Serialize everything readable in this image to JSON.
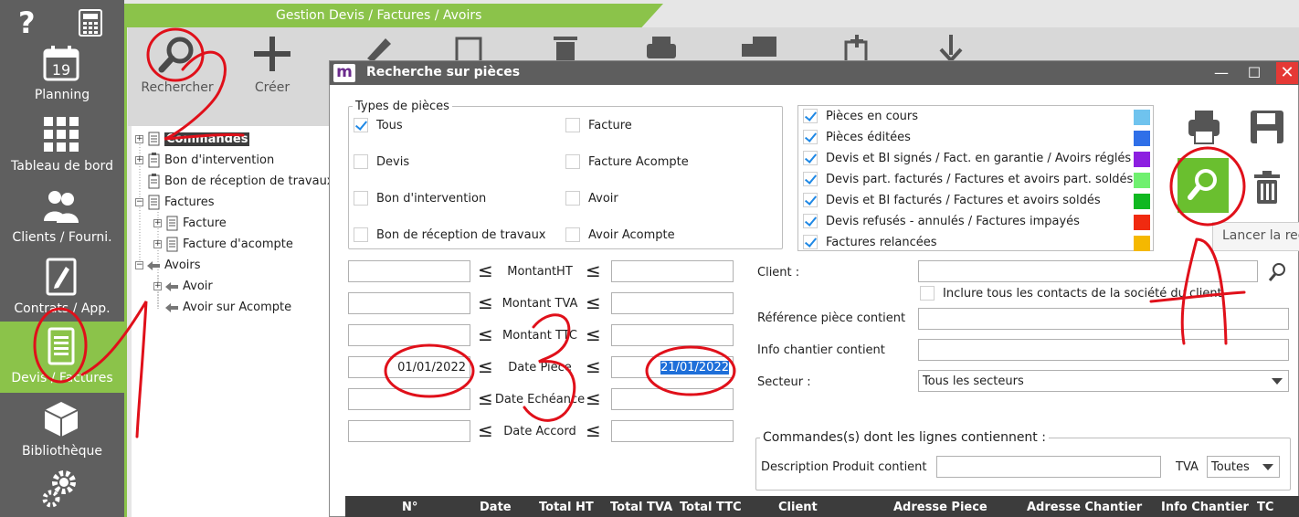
{
  "sidebar": {
    "help_label": "?",
    "items": [
      {
        "label": "Planning",
        "icon": "calendar-icon",
        "day": "19"
      },
      {
        "label": "Tableau de bord",
        "icon": "dashboard-grid-icon"
      },
      {
        "label": "Clients / Fourni.",
        "icon": "users-icon"
      },
      {
        "label": "Contrats / App.",
        "icon": "contract-icon"
      },
      {
        "label": "Devis / Factures",
        "icon": "document-icon",
        "active": true
      },
      {
        "label": "Bibliothèque",
        "icon": "cube-icon"
      }
    ]
  },
  "header": {
    "title": "Gestion Devis / Factures / Avoirs"
  },
  "toolbar": {
    "search_label": "Rechercher",
    "create_label": "Créer"
  },
  "tree": {
    "nodes": [
      {
        "label": "Commandes",
        "selected": true
      },
      {
        "label": "Bon d'intervention"
      },
      {
        "label": "Bon de réception de travaux"
      },
      {
        "label": "Factures"
      },
      {
        "label": "Facture"
      },
      {
        "label": "Facture d'acompte"
      },
      {
        "label": "Avoirs"
      },
      {
        "label": "Avoir"
      },
      {
        "label": "Avoir sur Acompte"
      }
    ]
  },
  "dialog": {
    "logo": "m",
    "title": "Recherche sur pièces",
    "types_legend": "Types de pièces",
    "types": [
      {
        "label": "Tous",
        "checked": true
      },
      {
        "label": "Facture",
        "checked": false
      },
      {
        "label": "Devis",
        "checked": false
      },
      {
        "label": "Facture Acompte",
        "checked": false
      },
      {
        "label": "Bon d'intervention",
        "checked": false
      },
      {
        "label": "Avoir",
        "checked": false
      },
      {
        "label": "Bon de réception de travaux",
        "checked": false
      },
      {
        "label": "Avoir Acompte",
        "checked": false
      }
    ],
    "statuses": [
      {
        "label": "Pièces en cours",
        "color": "#6fc3ee"
      },
      {
        "label": "Pièces éditées",
        "color": "#2f6fe8"
      },
      {
        "label": "Devis et BI signés / Fact. en garantie / Avoirs réglés",
        "color": "#8c1fe0"
      },
      {
        "label": "Devis part. facturés / Factures et avoirs part. soldés",
        "color": "#6ff06f"
      },
      {
        "label": "Devis et BI facturés / Factures  et avoirs soldés",
        "color": "#10b820"
      },
      {
        "label": "Devis refusés - annulés / Factures impayés",
        "color": "#f02a10"
      },
      {
        "label": "Factures relancées",
        "color": "#f5b800"
      }
    ],
    "tooltip": "Lancer la rech",
    "ranges": [
      {
        "label": "MontantHT",
        "from": "",
        "to": ""
      },
      {
        "label": "Montant TVA",
        "from": "",
        "to": ""
      },
      {
        "label": "Montant TTC",
        "from": "",
        "to": ""
      },
      {
        "label": "Date Pièce",
        "from": "01/01/2022",
        "to": "21/01/2022"
      },
      {
        "label": "Date Echéance",
        "from": "",
        "to": ""
      },
      {
        "label": "Date Accord",
        "from": "",
        "to": ""
      }
    ],
    "le_symbol": "≤",
    "client_label": "Client :",
    "client_value": "",
    "include_contacts_label": "Inclure tous les contacts de la société du client",
    "ref_label": "Référence pièce contient",
    "info_label": "Info chantier contient",
    "secteur_label": "Secteur :",
    "secteur_value": "Tous les secteurs",
    "commandes_legend": "Commandes(s) dont les lignes contiennent :",
    "desc_label": "Description Produit contient",
    "tva_label": "TVA",
    "tva_value": "Toutes",
    "grid_headers": [
      "N°",
      "Date",
      "Total HT",
      "Total TVA",
      "Total TTC",
      "Client",
      "Adresse Piece",
      "Adresse Chantier",
      "Info Chantier",
      "TC"
    ]
  }
}
